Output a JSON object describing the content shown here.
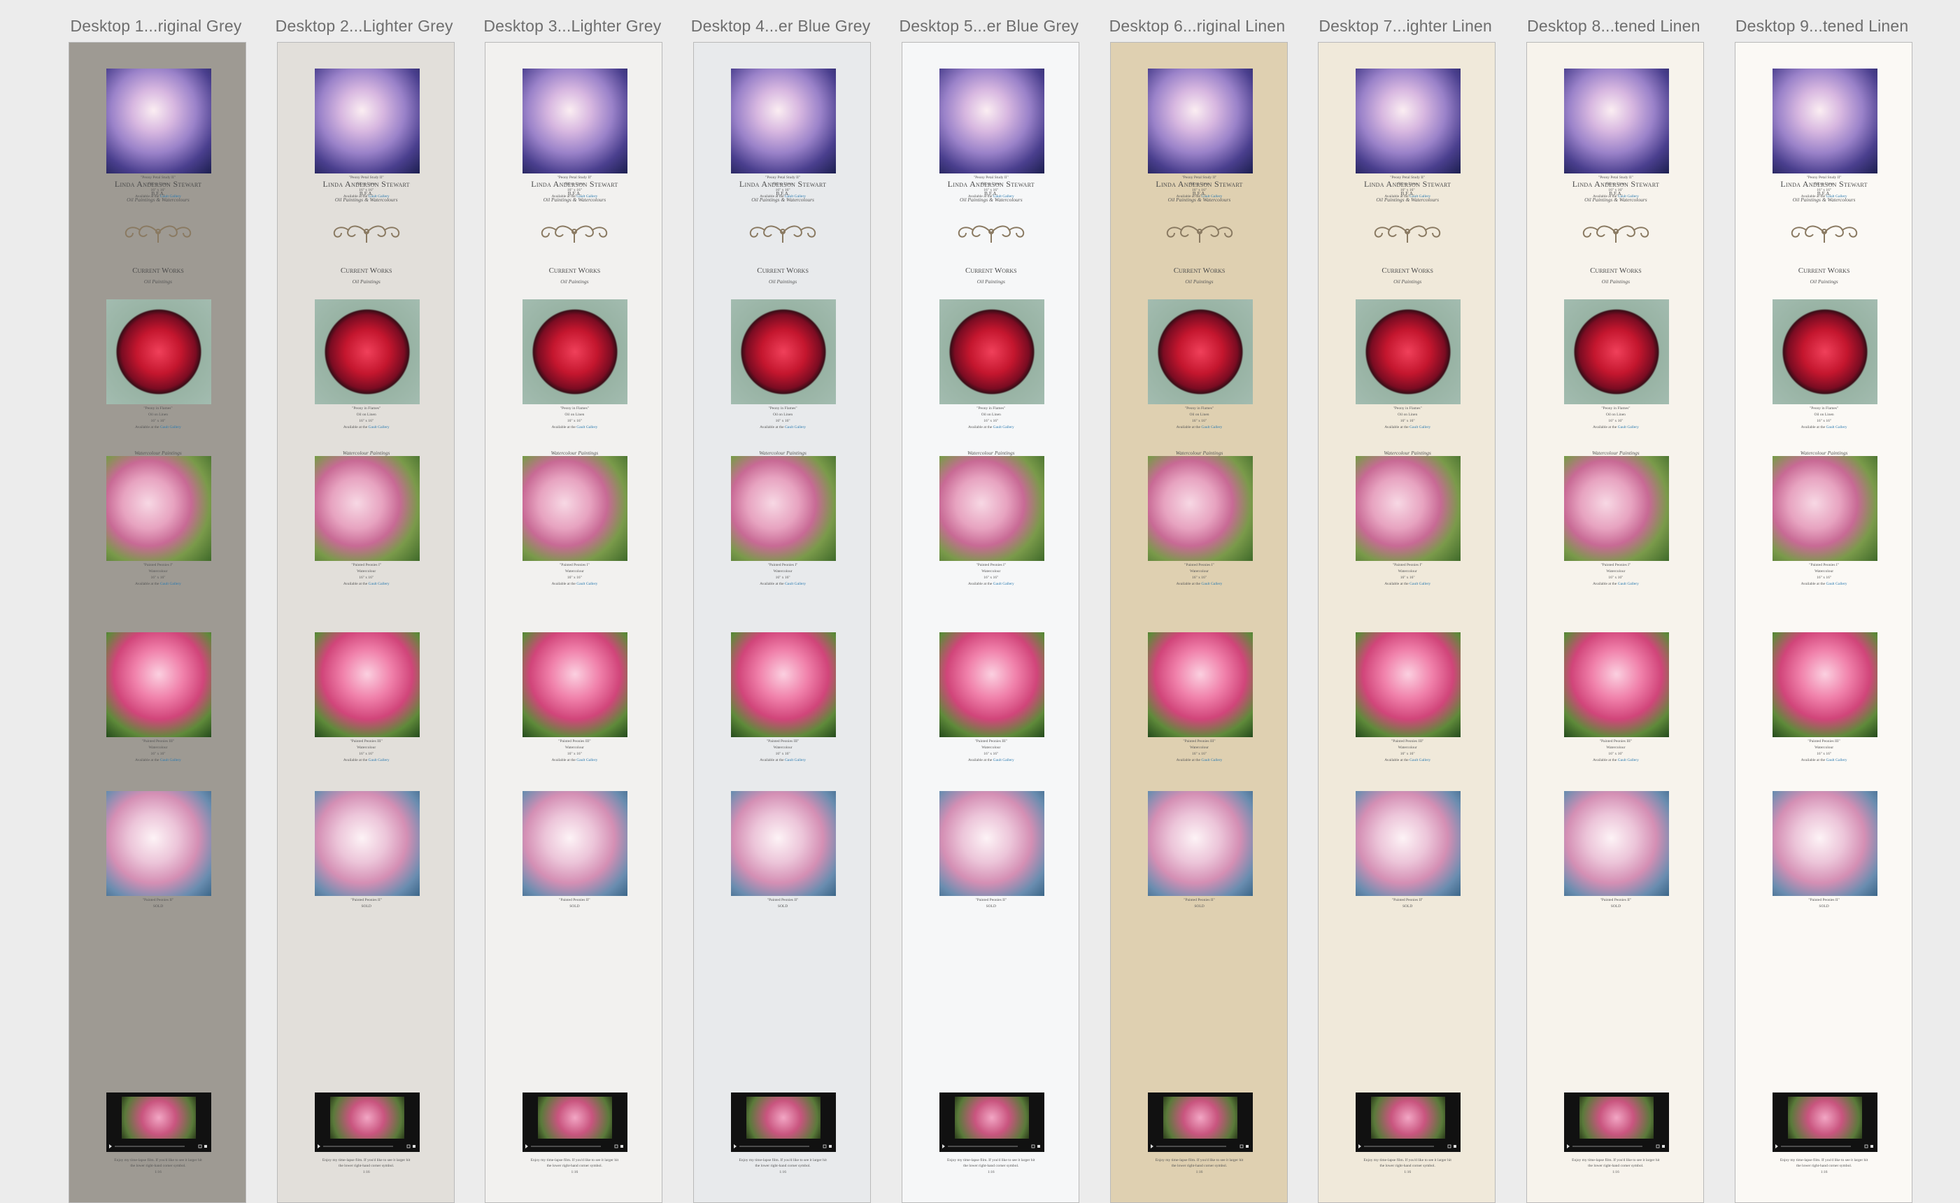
{
  "canvas_bg": "#ececec",
  "page_content": {
    "artist_name": "Linda Anderson Stewart",
    "degree": "B.F.A.",
    "mediums": "Oil Paintings & Watercolours",
    "section_title": "Current Works",
    "section_subtitle": "Oil Paintings",
    "watercolour_heading": "Watercolour Paintings",
    "available_prefix": "Available at the",
    "gallery_link": "Gault Gallery",
    "works": [
      {
        "title": "\"Peony Petal Study II\"",
        "medium": "Oil on Linen",
        "size": "16\" x 16\"",
        "available": true
      },
      {
        "title": "\"Peony in Flames\"",
        "medium": "Oil on Linen",
        "size": "16\" x 16\"",
        "available": true
      },
      {
        "title": "\"Painted Peonies I\"",
        "medium": "Watercolour",
        "size": "16\" x 16\"",
        "available": true
      },
      {
        "title": "\"Painted Peonies III\"",
        "medium": "Watercolour",
        "size": "16\" x 16\"",
        "available": true
      },
      {
        "title": "\"Painted Peonies II\"",
        "medium": "SOLD",
        "size": "",
        "available": false
      }
    ],
    "video_caption_1": "Enjoy my time-lapse film. If you'd like to see it larger hit",
    "video_caption_2": "the lower right-hand corner symbol.",
    "video_duration": "1:16"
  },
  "artboards": [
    {
      "title": "Desktop 1...riginal Grey",
      "bg": "#9e9a93"
    },
    {
      "title": "Desktop 2...Lighter Grey",
      "bg": "#e2dfda"
    },
    {
      "title": "Desktop 3...Lighter Grey",
      "bg": "#f2f1ef"
    },
    {
      "title": "Desktop 4...er Blue Grey",
      "bg": "#e8eaec"
    },
    {
      "title": "Desktop 5...er Blue Grey",
      "bg": "#f6f7f8"
    },
    {
      "title": "Desktop 6...riginal Linen",
      "bg": "#dfd0b1"
    },
    {
      "title": "Desktop 7...ighter Linen",
      "bg": "#f0e9da"
    },
    {
      "title": "Desktop 8...tened Linen",
      "bg": "#f7f3ec"
    },
    {
      "title": "Desktop 9...tened Linen",
      "bg": "#fbf9f5"
    }
  ]
}
